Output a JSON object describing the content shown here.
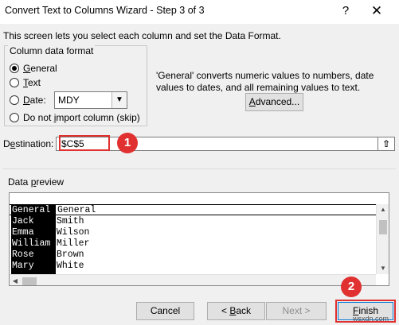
{
  "window": {
    "title": "Convert Text to Columns Wizard - Step 3 of 3",
    "help_label": "?",
    "close_label": "✕"
  },
  "intro_text": "This screen lets you select each column and set the Data Format.",
  "column_format": {
    "group_label": "Column data format",
    "options": [
      {
        "pre": "",
        "key": "G",
        "post": "eneral",
        "selected": true
      },
      {
        "pre": "",
        "key": "T",
        "post": "ext",
        "selected": false
      },
      {
        "pre": "",
        "key": "D",
        "post": "ate:",
        "selected": false
      },
      {
        "pre": "Do not ",
        "key": "i",
        "post": "mport column (skip)",
        "selected": false
      }
    ],
    "date_value": "MDY"
  },
  "general_note": "'General' converts numeric values to numbers, date values to dates, and all remaining values to text.",
  "advanced_button": {
    "pre": "",
    "key": "A",
    "post": "dvanced..."
  },
  "destination": {
    "label_pre": "D",
    "label_key": "e",
    "label_post": "stination:",
    "value": "$C$5",
    "collapse_icon": "⇧"
  },
  "callouts": {
    "first": "1",
    "second": "2"
  },
  "preview": {
    "label_pre": "Data ",
    "label_key": "p",
    "label_post": "review",
    "headers": [
      "General",
      "General"
    ],
    "rows": [
      [
        "Jack",
        "Smith"
      ],
      [
        "Emma",
        "Wilson"
      ],
      [
        "William",
        "Miller"
      ],
      [
        "Rose",
        "Brown"
      ],
      [
        "Mary",
        "White"
      ]
    ]
  },
  "buttons": {
    "cancel": "Cancel",
    "back_pre": "< ",
    "back_key": "B",
    "back_post": "ack",
    "next": "Next >",
    "finish_key": "F",
    "finish_post": "inish"
  },
  "watermark": "wsxdn.com"
}
